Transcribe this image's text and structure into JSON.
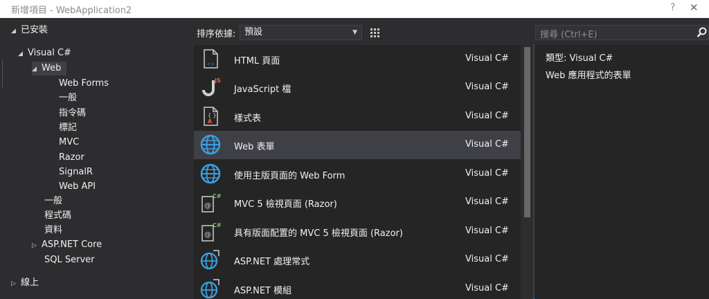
{
  "window": {
    "title": "新增項目 - WebApplication2",
    "help_label": "?",
    "close_label": "✕"
  },
  "tree": {
    "installed": "已安裝",
    "visual_csharp": "Visual C#",
    "web": "Web",
    "web_children": [
      "Web Forms",
      "一般",
      "指令碼",
      "標記",
      "MVC",
      "Razor",
      "SignalR",
      "Web API"
    ],
    "csharp_children": [
      "一般",
      "程式碼",
      "資料",
      "ASP.NET Core",
      "SQL Server"
    ],
    "online": "線上"
  },
  "toolbar": {
    "sort_label": "排序依據:",
    "sort_value": "預設"
  },
  "items": [
    {
      "name": "HTML 頁面",
      "lang": "Visual C#",
      "icon": "html-page-icon"
    },
    {
      "name": "JavaScript 檔",
      "lang": "Visual C#",
      "icon": "javascript-file-icon"
    },
    {
      "name": "樣式表",
      "lang": "Visual C#",
      "icon": "stylesheet-icon"
    },
    {
      "name": "Web 表單",
      "lang": "Visual C#",
      "icon": "globe-icon"
    },
    {
      "name": "使用主版頁面的 Web Form",
      "lang": "Visual C#",
      "icon": "globe-icon"
    },
    {
      "name": "MVC 5 檢視頁面 (Razor)",
      "lang": "Visual C#",
      "icon": "razor-view-icon"
    },
    {
      "name": "具有版面配置的 MVC 5 檢視頁面 (Razor)",
      "lang": "Visual C#",
      "icon": "razor-view-icon"
    },
    {
      "name": "ASP.NET 處理常式",
      "lang": "Visual C#",
      "icon": "handler-globe-icon"
    },
    {
      "name": "ASP.NET 模組",
      "lang": "Visual C#",
      "icon": "module-globe-icon"
    }
  ],
  "selected_index": 3,
  "search": {
    "placeholder": "搜尋 (Ctrl+E)"
  },
  "details": {
    "type_line": "類型:  Visual C#",
    "description": "Web 應用程式的表單"
  },
  "colors": {
    "accent": "#007acc",
    "globe": "#3c9fe0",
    "background": "#2d2d30",
    "list_background": "#252526",
    "selection": "#3f3f46"
  }
}
